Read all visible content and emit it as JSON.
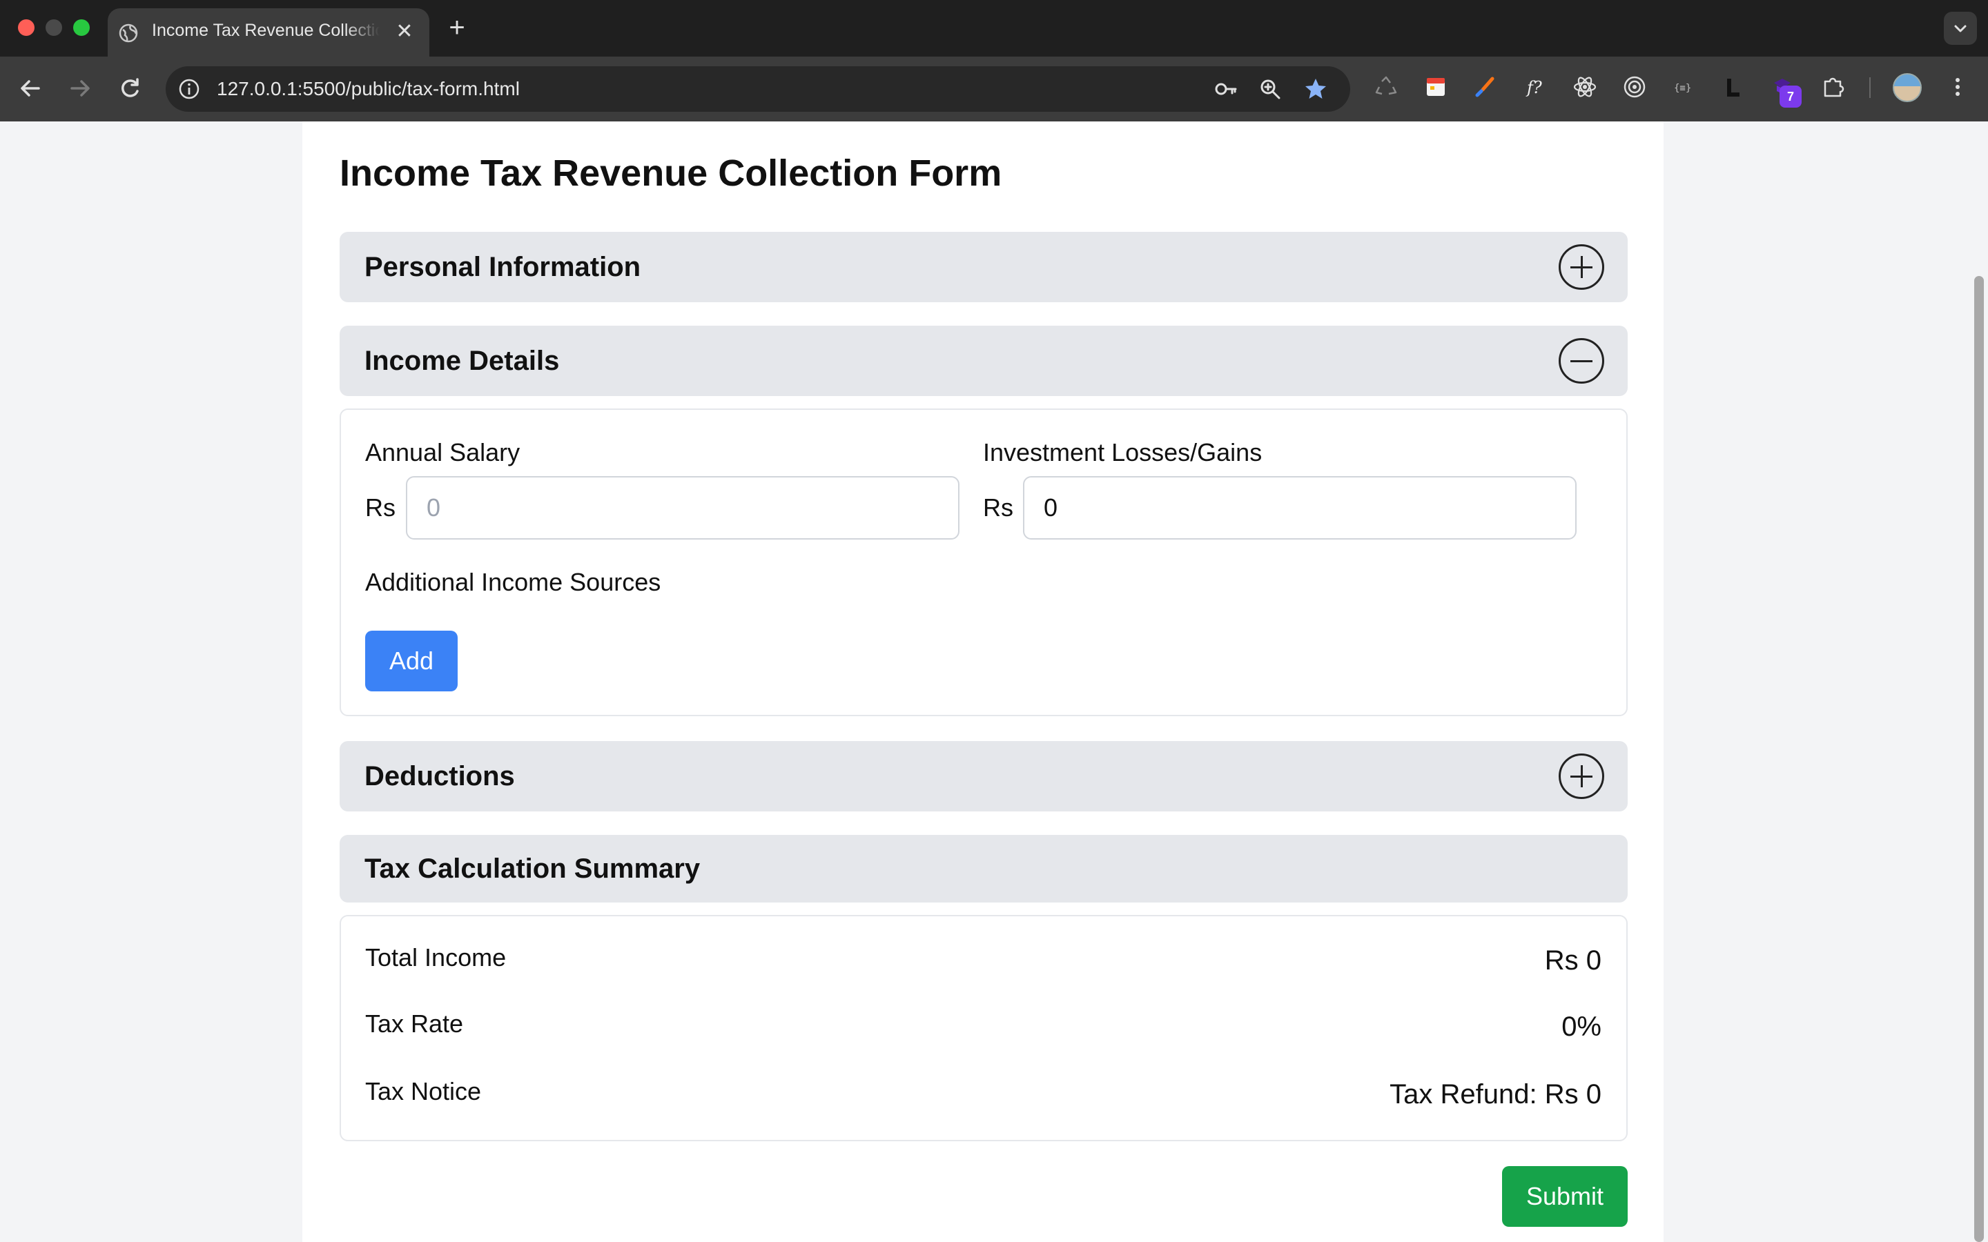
{
  "browser": {
    "tab_title": "Income Tax Revenue Collection Form",
    "tab_close": "✕",
    "new_tab": "+",
    "url": "127.0.0.1:5500/public/tax-form.html",
    "extension_badge": "7",
    "toolbar_icons": [
      "key-icon",
      "zoom-icon",
      "bookmark-star-icon"
    ],
    "extension_icons": [
      "recycle-icon",
      "calendar-icon",
      "brush-icon",
      "font-icon",
      "react-icon",
      "target-icon",
      "json-icon",
      "l-icon",
      "badge-extension-icon",
      "puzzle-icon"
    ],
    "accent_color": "#8ab4f8"
  },
  "form": {
    "title": "Income Tax Revenue Collection Form",
    "sections": {
      "personal": {
        "title": "Personal Information",
        "expanded": false
      },
      "income": {
        "title": "Income Details",
        "expanded": true
      },
      "deductions": {
        "title": "Deductions",
        "expanded": false
      },
      "summary": {
        "title": "Tax Calculation Summary"
      }
    },
    "income": {
      "annual_salary_label": "Annual Salary",
      "annual_salary_prefix": "Rs",
      "annual_salary_placeholder": "0",
      "annual_salary_value": "",
      "investment_label": "Investment Losses/Gains",
      "investment_prefix": "Rs",
      "investment_value": "0",
      "additional_label": "Additional Income Sources",
      "add_button": "Add"
    },
    "summary": {
      "total_income_label": "Total Income",
      "total_income_value": "Rs 0",
      "tax_rate_label": "Tax Rate",
      "tax_rate_value": "0%",
      "tax_notice_label": "Tax Notice",
      "tax_notice_value": "Tax Refund: Rs 0"
    },
    "submit_button": "Submit",
    "colors": {
      "add_button": "#3b82f6",
      "submit_button": "#16a34a",
      "section_header": "#e5e7eb"
    }
  }
}
